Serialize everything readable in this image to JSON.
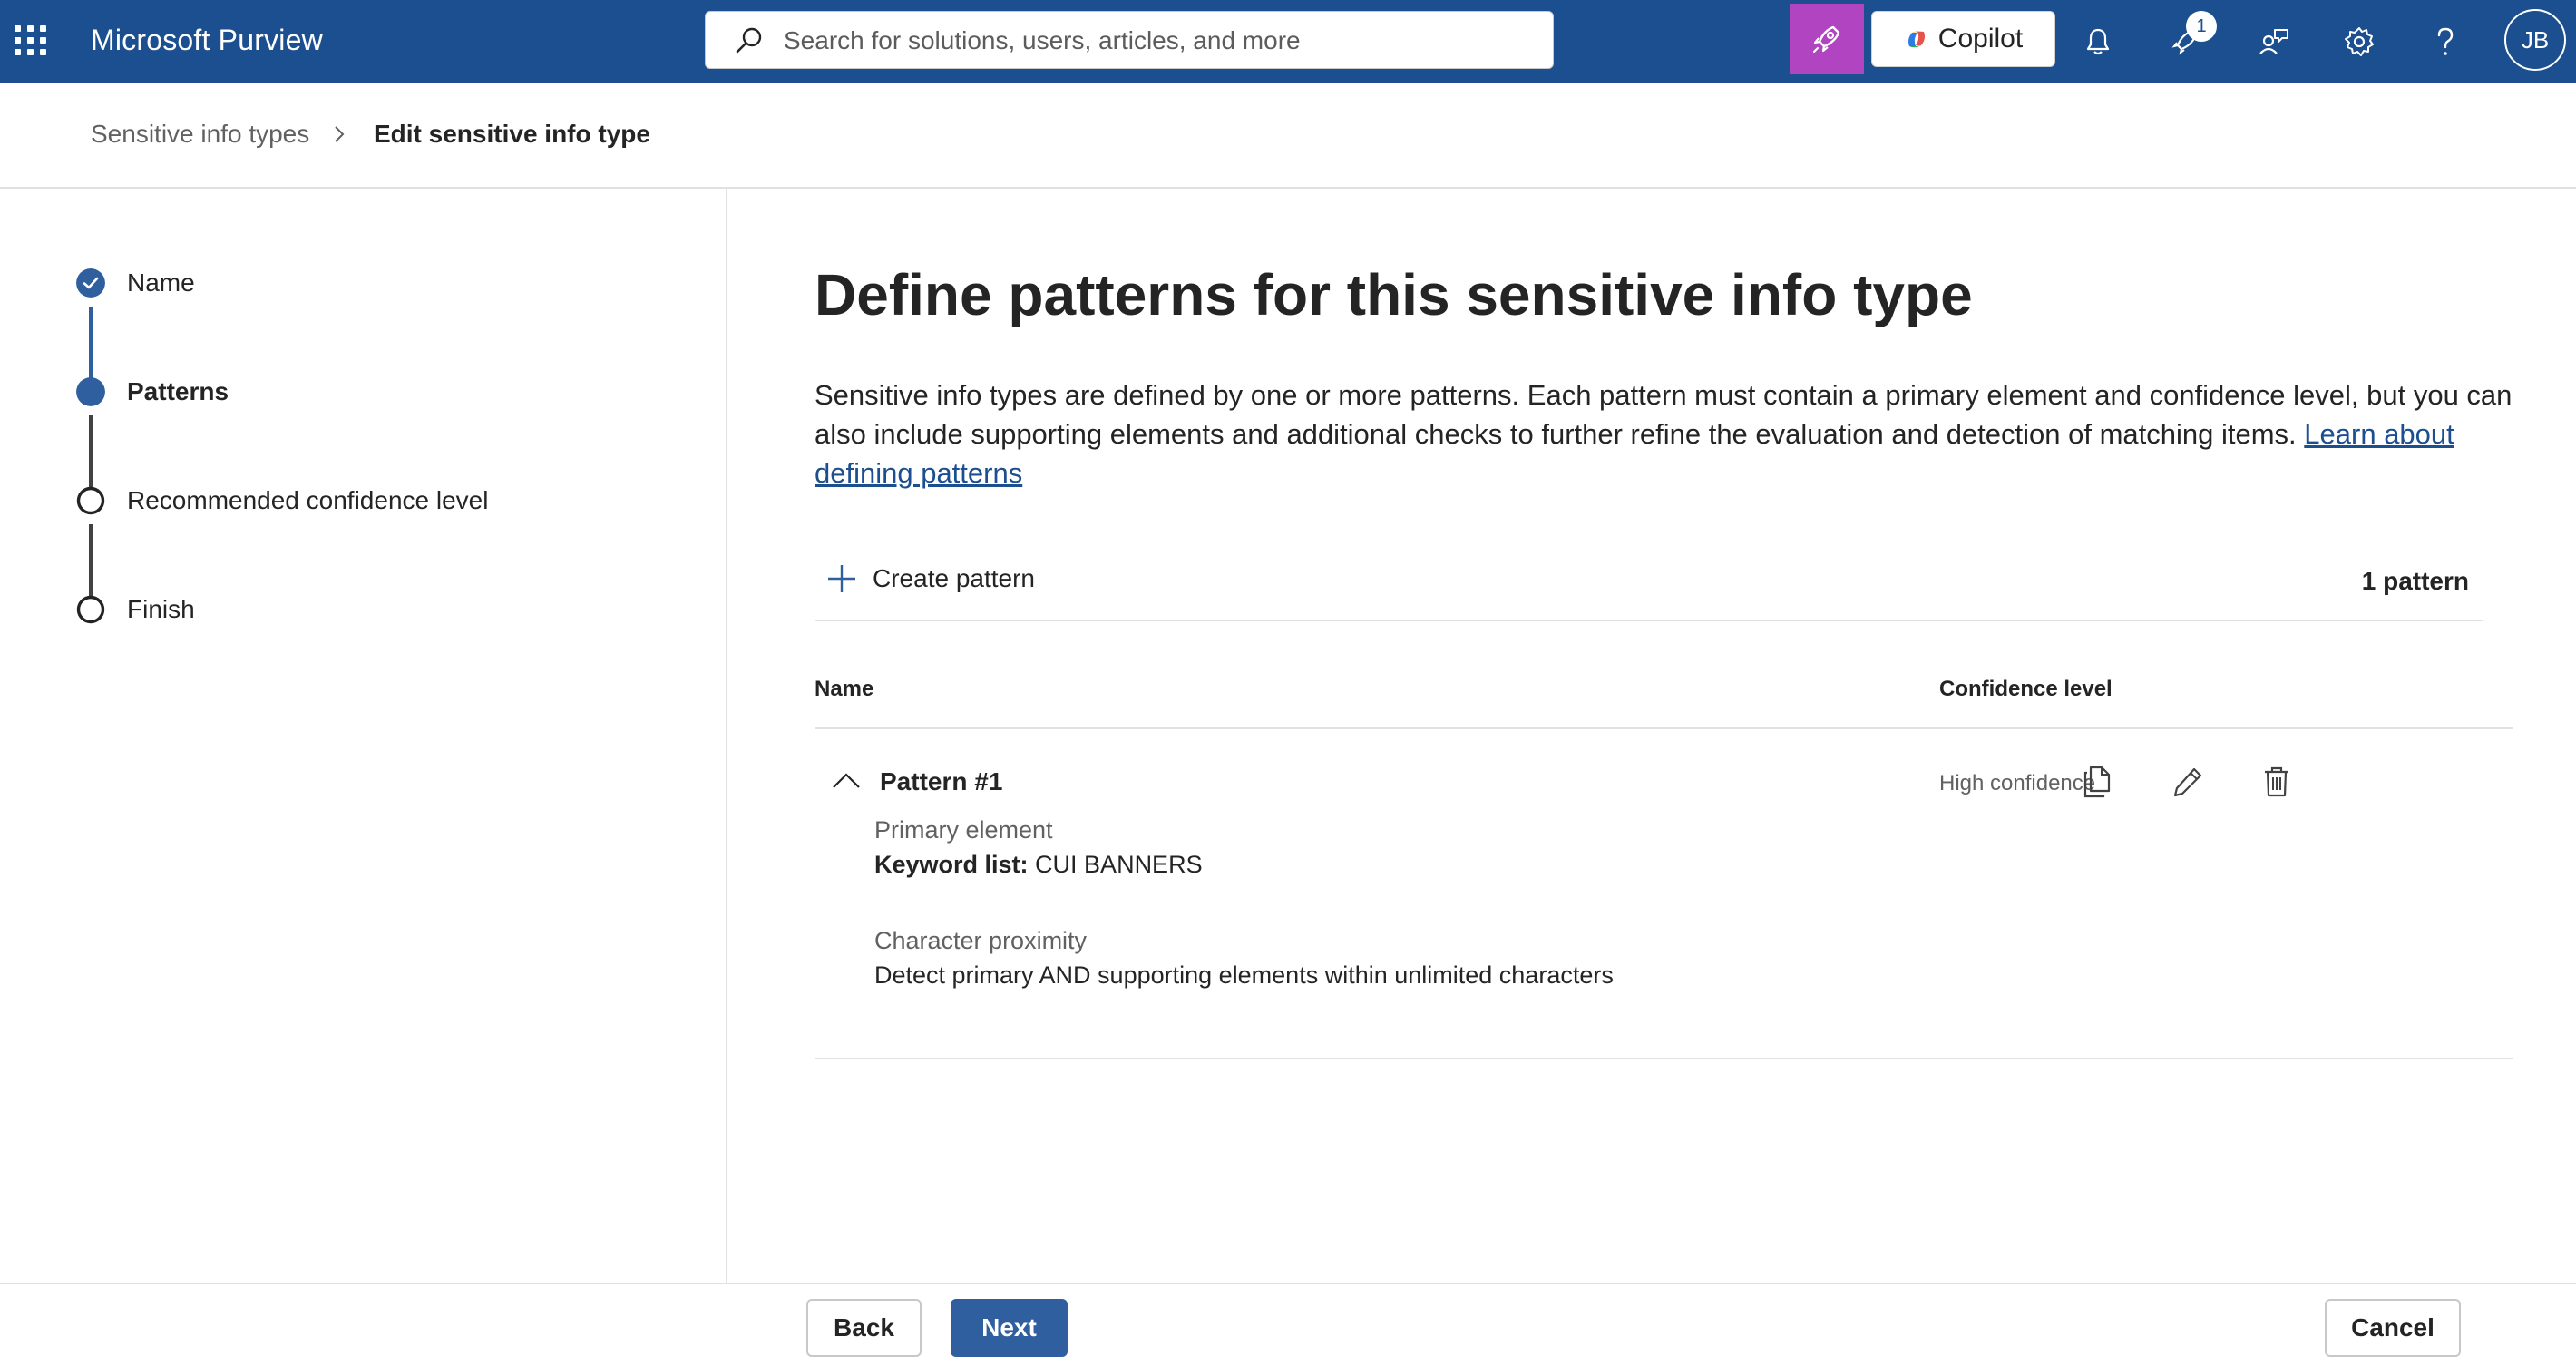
{
  "topbar": {
    "app_title": "Microsoft Purview",
    "search_placeholder": "Search for solutions, users, articles, and more",
    "copilot_label": "Copilot",
    "notification_badge": "1",
    "avatar_initials": "JB",
    "accent_color": "#1b4f8f",
    "rocket_color": "#b144c0",
    "icons": [
      "waffle-icon",
      "search-icon",
      "rocket-icon",
      "copilot-icon",
      "bell-icon",
      "rocket-badge-icon",
      "people-icon",
      "gear-icon",
      "help-icon"
    ]
  },
  "breadcrumb": {
    "root": "Sensitive info types",
    "current": "Edit sensitive info type"
  },
  "stepper": {
    "steps": [
      {
        "label": "Name",
        "state": "completed"
      },
      {
        "label": "Patterns",
        "state": "current"
      },
      {
        "label": "Recommended confidence level",
        "state": "pending"
      },
      {
        "label": "Finish",
        "state": "pending"
      }
    ]
  },
  "main": {
    "title": "Define patterns for this sensitive info type",
    "description": "Sensitive info types are defined by one or more patterns. Each pattern must contain a primary element and confidence level, but you can also include supporting elements and additional checks to further refine the evaluation and detection of matching items.",
    "learn_link": "Learn about defining patterns",
    "create_label": "Create pattern",
    "count_label": "1 pattern",
    "columns": {
      "name": "Name",
      "confidence": "Confidence level"
    },
    "patterns": [
      {
        "name": "Pattern #1",
        "confidence": "High confidence",
        "primary_element_label": "Primary element",
        "keyword_label": "Keyword list:",
        "keyword_value": "CUI BANNERS",
        "proximity_label": "Character proximity",
        "proximity_value": "Detect primary AND supporting elements within unlimited characters"
      }
    ]
  },
  "footer": {
    "back_label": "Back",
    "next_label": "Next",
    "cancel_label": "Cancel"
  }
}
